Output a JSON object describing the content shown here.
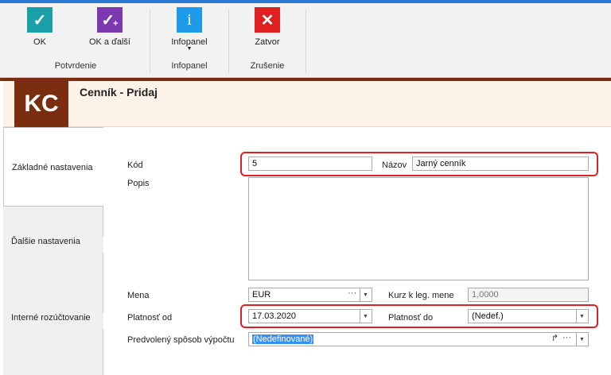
{
  "ribbon": {
    "ok_label": "OK",
    "ok_next_label": "OK a ďalší",
    "infopanel_label": "Infopanel",
    "close_label": "Zatvor",
    "groups": {
      "confirm": "Potvrdenie",
      "infopanel": "Infopanel",
      "cancel": "Zrušenie"
    },
    "colors": {
      "ok": "#1aa0a8",
      "ok_next": "#7d3ab0",
      "info": "#1e9be8",
      "close": "#e02020"
    }
  },
  "header": {
    "logo": "KC",
    "title": "Cenník - Pridaj"
  },
  "tabs": [
    {
      "label": "Základné nastavenia"
    },
    {
      "label": "Ďalšie nastavenia"
    },
    {
      "label": "Interné rozúčtovanie"
    }
  ],
  "form": {
    "code_label": "Kód",
    "code_value": "5",
    "name_label": "Názov",
    "name_value": "Jarný cenník",
    "desc_label": "Popis",
    "currency_label": "Mena",
    "currency_value": "EUR",
    "rate_label": "Kurz k leg. mene",
    "rate_value": "1,0000",
    "valid_from_label": "Platnosť od",
    "valid_from_value": "17.03.2020",
    "valid_to_label": "Platnosť do",
    "valid_to_value": "(Nedef.)",
    "calc_label": "Predvolený spôsob výpočtu",
    "calc_value": "(Nedefinované)"
  }
}
